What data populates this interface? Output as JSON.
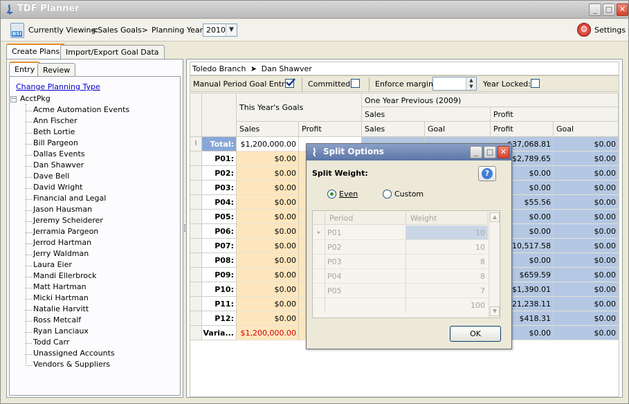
{
  "window": {
    "title": "TDF Planner",
    "minimize": "_",
    "maximize": "□",
    "close": "✕"
  },
  "toolbar": {
    "bsi_badge": "BSI",
    "currently_viewing_label": "Currently Viewing:",
    "currently_viewing_value": "<Sales Goals>",
    "planning_year_label": "Planning Year:",
    "planning_year_value": "2010",
    "settings_label": "Settings"
  },
  "main_tabs": [
    {
      "label": "Create Plans",
      "active": true
    },
    {
      "label": "Import/Export Goal Data",
      "active": false
    }
  ],
  "sub_tabs": [
    {
      "label": "Entry",
      "active": true
    },
    {
      "label": "Review",
      "active": false
    }
  ],
  "tree": {
    "change_link": "Change Planning Type",
    "root": "AcctPkg",
    "root_expander": "−",
    "items": [
      "Acme Automation Events",
      "Ann Fischer",
      "Beth Lortie",
      "Bill Pargeon",
      "Dallas Events",
      "Dan Shawver",
      "Dave Bell",
      "David Wright",
      "Financial and Legal",
      "Jason Hausman",
      "Jeremy Scheiderer",
      "Jerramia Pargeon",
      "Jerrod Hartman",
      "Jerry Waldman",
      "Laura Eier",
      "Mandi Ellerbrock",
      "Matt Hartman",
      "Micki Hartman",
      "Natalie Harvitt",
      "Ross Metcalf",
      "Ryan Lanciaux",
      "Todd Carr",
      "Unassigned Accounts",
      "Vendors & Suppliers"
    ]
  },
  "breadcrumb": {
    "branch": "Toledo Branch",
    "separator": "➤",
    "person": "Dan Shawver"
  },
  "options": {
    "manual_entry_label": "Manual Period Goal Entry:",
    "manual_entry_checked": true,
    "committed_label": "Committed:",
    "committed_checked": false,
    "enforce_margin_label": "Enforce margin:",
    "enforce_margin_value": "",
    "year_locked_label": "Year Locked:",
    "year_locked_checked": false
  },
  "grid": {
    "group_this_year": "This Year's Goals",
    "group_prev_year": "One Year Previous (2009)",
    "sub_sales": "Sales",
    "sub_profit": "Profit",
    "columns": [
      "Sales",
      "Profit",
      "Sales",
      "Goal",
      "Profit",
      "Goal"
    ],
    "row_cursor": "I",
    "rows": [
      {
        "label": "Total:",
        "tyg_sales": "$1,200,000.00",
        "tyg_profit": "",
        "prev_sales": "",
        "prev_sales_goal": "",
        "prev_profit": "$37,068.81",
        "prev_profit_goal": "$0.00",
        "total": true
      },
      {
        "label": "P01:",
        "tyg_sales": "$0.00",
        "prev_profit": "$2,789.65",
        "prev_profit_goal": "$0.00"
      },
      {
        "label": "P02:",
        "tyg_sales": "$0.00",
        "prev_profit": "$0.00",
        "prev_profit_goal": "$0.00"
      },
      {
        "label": "P03:",
        "tyg_sales": "$0.00",
        "prev_profit": "$0.00",
        "prev_profit_goal": "$0.00"
      },
      {
        "label": "P04:",
        "tyg_sales": "$0.00",
        "prev_profit": "$55.56",
        "prev_profit_goal": "$0.00"
      },
      {
        "label": "P05:",
        "tyg_sales": "$0.00",
        "prev_profit": "$0.00",
        "prev_profit_goal": "$0.00"
      },
      {
        "label": "P06:",
        "tyg_sales": "$0.00",
        "prev_profit": "$0.00",
        "prev_profit_goal": "$0.00"
      },
      {
        "label": "P07:",
        "tyg_sales": "$0.00",
        "prev_profit": "$10,517.58",
        "prev_profit_goal": "$0.00"
      },
      {
        "label": "P08:",
        "tyg_sales": "$0.00",
        "prev_profit": "$0.00",
        "prev_profit_goal": "$0.00"
      },
      {
        "label": "P09:",
        "tyg_sales": "$0.00",
        "prev_profit": "$659.59",
        "prev_profit_goal": "$0.00"
      },
      {
        "label": "P10:",
        "tyg_sales": "$0.00",
        "prev_profit": "$1,390.01",
        "prev_profit_goal": "$0.00"
      },
      {
        "label": "P11:",
        "tyg_sales": "$0.00",
        "prev_profit": "$21,238.11",
        "prev_profit_goal": "$0.00"
      },
      {
        "label": "P12:",
        "tyg_sales": "$0.00",
        "prev_profit": "$418.31",
        "prev_profit_goal": "$0.00"
      },
      {
        "label": "Varia...",
        "tyg_sales": "$1,200,000.00",
        "prev_profit": "$0.00",
        "prev_profit_goal": "$0.00",
        "variance": true
      }
    ]
  },
  "dialog": {
    "title": "Split Options",
    "split_weight_label": "Split Weight:",
    "help": "?",
    "option_even": "Even",
    "option_custom": "Custom",
    "even_selected": true,
    "weight_headers": [
      "Period",
      "Weight"
    ],
    "weight_rows": [
      {
        "period": "P01",
        "weight": "10"
      },
      {
        "period": "P02",
        "weight": "10"
      },
      {
        "period": "P03",
        "weight": "8"
      },
      {
        "period": "P04",
        "weight": "8"
      },
      {
        "period": "P05",
        "weight": "7"
      }
    ],
    "weight_total": "100",
    "ok_label": "OK"
  }
}
